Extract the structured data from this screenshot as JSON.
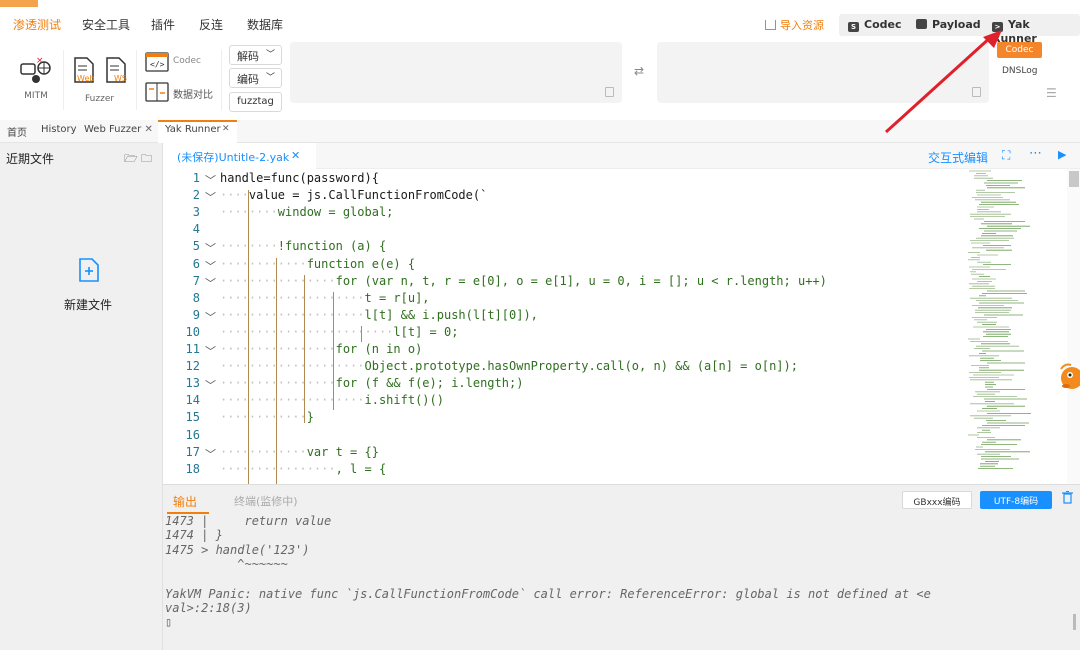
{
  "topnav": {
    "tabs": [
      "渗透测试",
      "安全工具",
      "插件",
      "反连",
      "数据库"
    ],
    "active_tab": "渗透测试",
    "import_resource": "导入资源",
    "codec_btn": "Codec",
    "payload_btn": "Payload",
    "yakrunner_btn": "Yak Runner"
  },
  "toolbar": {
    "mitm_label": "MITM",
    "web_label": "Web",
    "ws_label": "WS",
    "fuzzer_label": "Fuzzer",
    "codec_label": "Codec",
    "compare_label": "数据对比",
    "decode_select": "解码",
    "encode_select": "编码",
    "fuzztag_btn": "fuzztag",
    "codec_tag": "Codec",
    "dnslog_tag": "DNSLog"
  },
  "pagetabs": [
    {
      "label": "首页",
      "closable": false
    },
    {
      "label": "History",
      "closable": false
    },
    {
      "label": "Web Fuzzer",
      "closable": true
    },
    {
      "label": "Yak Runner",
      "closable": true
    }
  ],
  "sidebar": {
    "title": "近期文件",
    "new_file": "新建文件"
  },
  "editor": {
    "file_tab": "(未保存)Untitle-2.yak",
    "interactive_edit": "交互式编辑",
    "lines": [
      {
        "n": "1",
        "fold": true,
        "text": "handle=func(password){"
      },
      {
        "n": "2",
        "fold": true,
        "text": "    value = js.CallFunctionFromCode(`"
      },
      {
        "n": "3",
        "fold": false,
        "text": "        window = global;"
      },
      {
        "n": "4",
        "fold": false,
        "text": ""
      },
      {
        "n": "5",
        "fold": true,
        "text": "        !function (a) {"
      },
      {
        "n": "6",
        "fold": true,
        "text": "            function e(e) {"
      },
      {
        "n": "7",
        "fold": true,
        "text": "                for (var n, t, r = e[0], o = e[1], u = 0, i = []; u < r.length; u++)"
      },
      {
        "n": "8",
        "fold": false,
        "text": "                    t = r[u],"
      },
      {
        "n": "9",
        "fold": true,
        "text": "                    l[t] && i.push(l[t][0]),"
      },
      {
        "n": "10",
        "fold": false,
        "text": "                        l[t] = 0;"
      },
      {
        "n": "11",
        "fold": true,
        "text": "                for (n in o)"
      },
      {
        "n": "12",
        "fold": false,
        "text": "                    Object.prototype.hasOwnProperty.call(o, n) && (a[n] = o[n]);"
      },
      {
        "n": "13",
        "fold": true,
        "text": "                for (f && f(e); i.length;)"
      },
      {
        "n": "14",
        "fold": false,
        "text": "                    i.shift()()"
      },
      {
        "n": "15",
        "fold": false,
        "text": "            }"
      },
      {
        "n": "16",
        "fold": false,
        "text": ""
      },
      {
        "n": "17",
        "fold": true,
        "text": "            var t = {}"
      },
      {
        "n": "18",
        "fold": false,
        "text": "                , l = {"
      }
    ]
  },
  "output": {
    "tab_output": "输出",
    "tab_terminal": "终端(监修中)",
    "btn_gbk": "GBxxx编码",
    "btn_utf8": "UTF-8编码",
    "lines": [
      "1473 |     return value",
      "1474 | }",
      "1475 > handle('123')",
      "          ^~~~~~~",
      "",
      "YakVM Panic: native func `js.CallFunctionFromCode` call error: ReferenceError: global is not defined at <e",
      "val>:2:18(3)",
      "▯"
    ]
  },
  "colors": {
    "accent": "#f17f0e",
    "primary_blue": "#1890ff",
    "arrow_red": "#e0202a"
  }
}
